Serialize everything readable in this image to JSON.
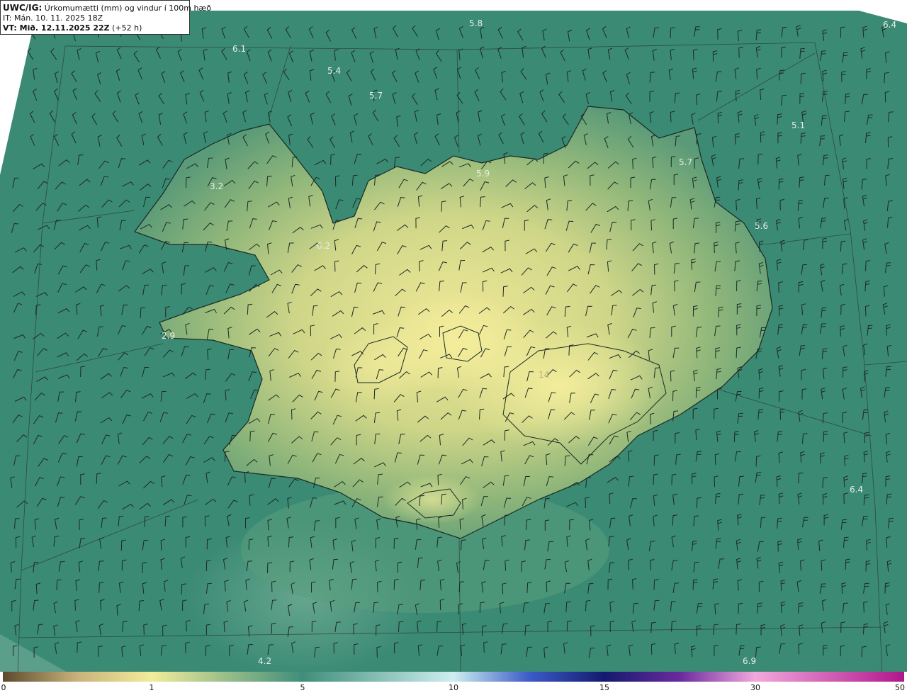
{
  "header": {
    "model_code": "UWC/IG:",
    "title": "Úrkomumætti (mm) og vindur í 100m hæð",
    "initial_time": "IT: Mán. 10. 11. 2025 18Z",
    "valid_label": "VT: Mið. 12.11.2025 22Z",
    "valid_offset": "(+52 h)"
  },
  "legend": {
    "ticks": [
      "0",
      "1",
      "5",
      "10",
      "15",
      "30",
      "50"
    ],
    "colors": {
      "low": "#5c4a2e",
      "tan": "#c9b27a",
      "yellow": "#f2ec9a",
      "teal": "#3f8e7a",
      "light_cyan": "#cfeef0",
      "blue": "#3c5cc8",
      "navy": "#141a6e",
      "purple": "#6a2a9e",
      "pink": "#f2a8dc",
      "magenta": "#b0168c"
    }
  },
  "map_labels": [
    "5.8",
    "6.4",
    "6.1",
    "5.4",
    "5.7",
    "5.1",
    "5.7",
    "5.9",
    "3.2",
    "5.6",
    "6.2",
    "2.9",
    "14",
    "6.4",
    "4.2",
    "6.9"
  ]
}
